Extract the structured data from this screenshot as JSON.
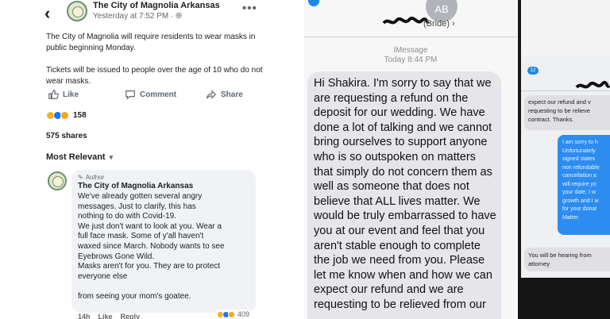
{
  "facebook": {
    "back_icon": "chevron-left-icon",
    "page_name": "The City of Magnolia Arkansas",
    "post_time": "Yesterday at 7:52 PM · ",
    "globe_icon": "globe-icon",
    "more_icon": "more-options-icon",
    "more_label": "•••",
    "post_text": [
      "The City of Magnolia will require residents to wear masks in public beginning Monday.",
      "Tickets will be issued to people over the age of 10 who do not wear masks."
    ],
    "actions": {
      "like": "Like",
      "comment": "Comment",
      "share": "Share"
    },
    "reaction_count": "158",
    "shares": "575 shares",
    "sort_label": "Most Relevant",
    "comment": {
      "badge": "Author",
      "author": "The City of Magnolia Arkansas",
      "lines": [
        "We've already gotten several angry",
        "messages. Just to clarify, this has",
        "nothing to do with Covid-19.",
        "We just don't want to look at you. Wear a",
        "full face mask. Some of y'all haven't",
        "waxed since March. Nobody wants to see",
        "Eyebrows Gone Wild.",
        "Masks aren't for you. They are to protect",
        "everyone else",
        "",
        "from seeing your mom's goatee."
      ],
      "reaction_count": "409",
      "age": "14h",
      "like": "Like",
      "reply": "Reply"
    }
  },
  "imessage": {
    "avatar_initials": "AB",
    "contact_label": "(Bride) ›",
    "service": "iMessage",
    "time": "Today 8:44 PM",
    "message_lines": [
      "Hi Shakira. I'm sorry to say that we",
      "are requesting a refund on the",
      "deposit for our wedding. We have",
      "done a lot of talking and we cannot",
      "bring ourselves to support anyone",
      "who is so outspoken on matters",
      "that simply do not concern them as",
      "well as someone that does not",
      "believe that ALL lives matter. We",
      "would be truly embarrassed to have",
      "you at our event and feel that you",
      "aren't stable enough to complete",
      "the job we need from you. Please",
      "let me know when and how we can",
      "expect our refund and we are",
      "requesting to be relieved from our"
    ]
  },
  "contract_chat": {
    "badge": "12",
    "gray_lines": [
      "expect our refund and v",
      "requesting to be relieve",
      "contract. Thanks."
    ],
    "blue_lines": [
      "I am sorry to h",
      "Unfortunately",
      "signed states",
      "non refundable",
      "cancellation a",
      "will require yo",
      "your date. I w",
      "growth and I w",
      "for your donat",
      "Matter."
    ],
    "reply_lines": [
      "You will be hearing from",
      "attorney"
    ]
  },
  "colors": {
    "facebook_blue": "#1877f2",
    "imessage_gray_bubble": "#e5e5ea",
    "imessage_blue_bubble": "#2d8cf0"
  }
}
